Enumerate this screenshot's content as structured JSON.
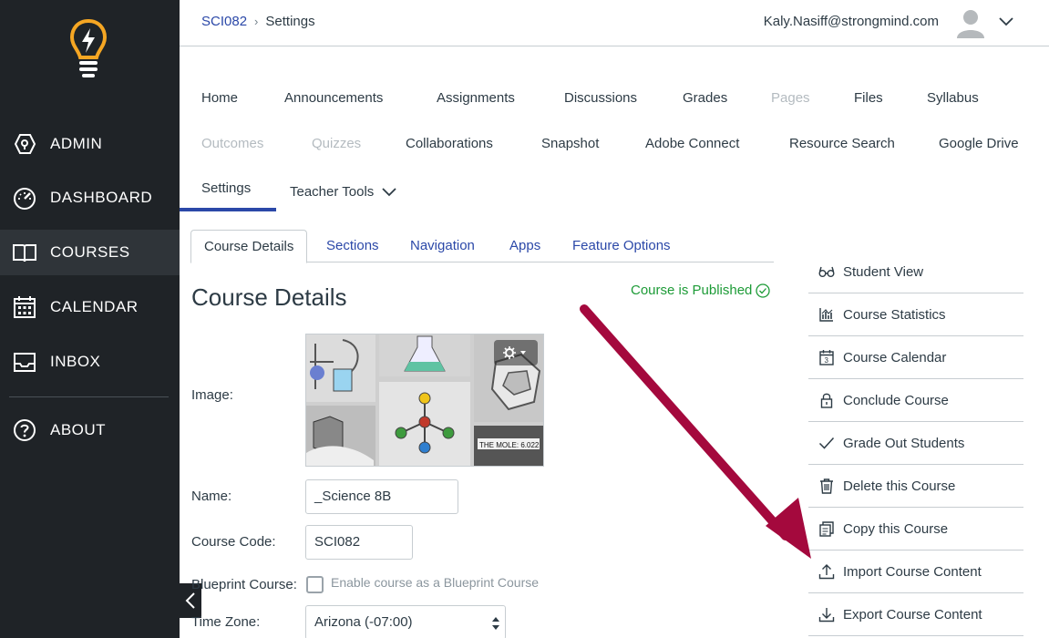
{
  "sidebar": {
    "items": [
      {
        "label": "ADMIN",
        "icon": "shield-icon"
      },
      {
        "label": "DASHBOARD",
        "icon": "dashboard-icon"
      },
      {
        "label": "COURSES",
        "icon": "book-icon"
      },
      {
        "label": "CALENDAR",
        "icon": "calendar-icon"
      },
      {
        "label": "INBOX",
        "icon": "inbox-icon"
      },
      {
        "label": "ABOUT",
        "icon": "help-icon"
      }
    ],
    "active": "COURSES",
    "logo": "lightbulb-logo-icon"
  },
  "header": {
    "breadcrumb": [
      "SCI082",
      "Settings"
    ],
    "user_email": "Kaly.Nasiff@strongmind.com"
  },
  "course_nav": {
    "row1": [
      "Home",
      "Announcements",
      "Assignments",
      "Discussions",
      "Grades",
      "Pages",
      "Files",
      "Syllabus"
    ],
    "row2": [
      "Outcomes",
      "Quizzes",
      "Collaborations",
      "Snapshot",
      "Adobe Connect",
      "Resource Search",
      "Google Drive"
    ],
    "row3": [
      "Settings",
      "Teacher Tools"
    ],
    "disabled": [
      "Pages",
      "Outcomes",
      "Quizzes"
    ]
  },
  "tabs": [
    "Course Details",
    "Sections",
    "Navigation",
    "Apps",
    "Feature Options"
  ],
  "content": {
    "title": "Course Details",
    "status": "Course is Published",
    "image_label": "Image:",
    "image_caption": "THE MOLE: 6.022",
    "name_label": "Name:",
    "name_value": "_Science 8B",
    "code_label": "Course Code:",
    "code_value": "SCI082",
    "blueprint_label": "Blueprint Course:",
    "blueprint_text": "Enable course as a Blueprint Course",
    "timezone_label": "Time Zone:",
    "timezone_value": "Arizona (-07:00)"
  },
  "actions": [
    {
      "label": "Student View",
      "icon": "glasses-icon"
    },
    {
      "label": "Course Statistics",
      "icon": "statistics-icon"
    },
    {
      "label": "Course Calendar",
      "icon": "calendar-day-icon"
    },
    {
      "label": "Conclude Course",
      "icon": "lock-icon"
    },
    {
      "label": "Grade Out Students",
      "icon": "checkmark-icon"
    },
    {
      "label": "Delete this Course",
      "icon": "trash-icon"
    },
    {
      "label": "Copy this Course",
      "icon": "copy-icon"
    },
    {
      "label": "Import Course Content",
      "icon": "upload-icon"
    },
    {
      "label": "Export Course Content",
      "icon": "download-icon"
    }
  ],
  "colors": {
    "sidebar_bg": "#1f2327",
    "link_blue": "#2b48a8",
    "published_green": "#1d9b37",
    "annotation_arrow": "#a4093d"
  }
}
